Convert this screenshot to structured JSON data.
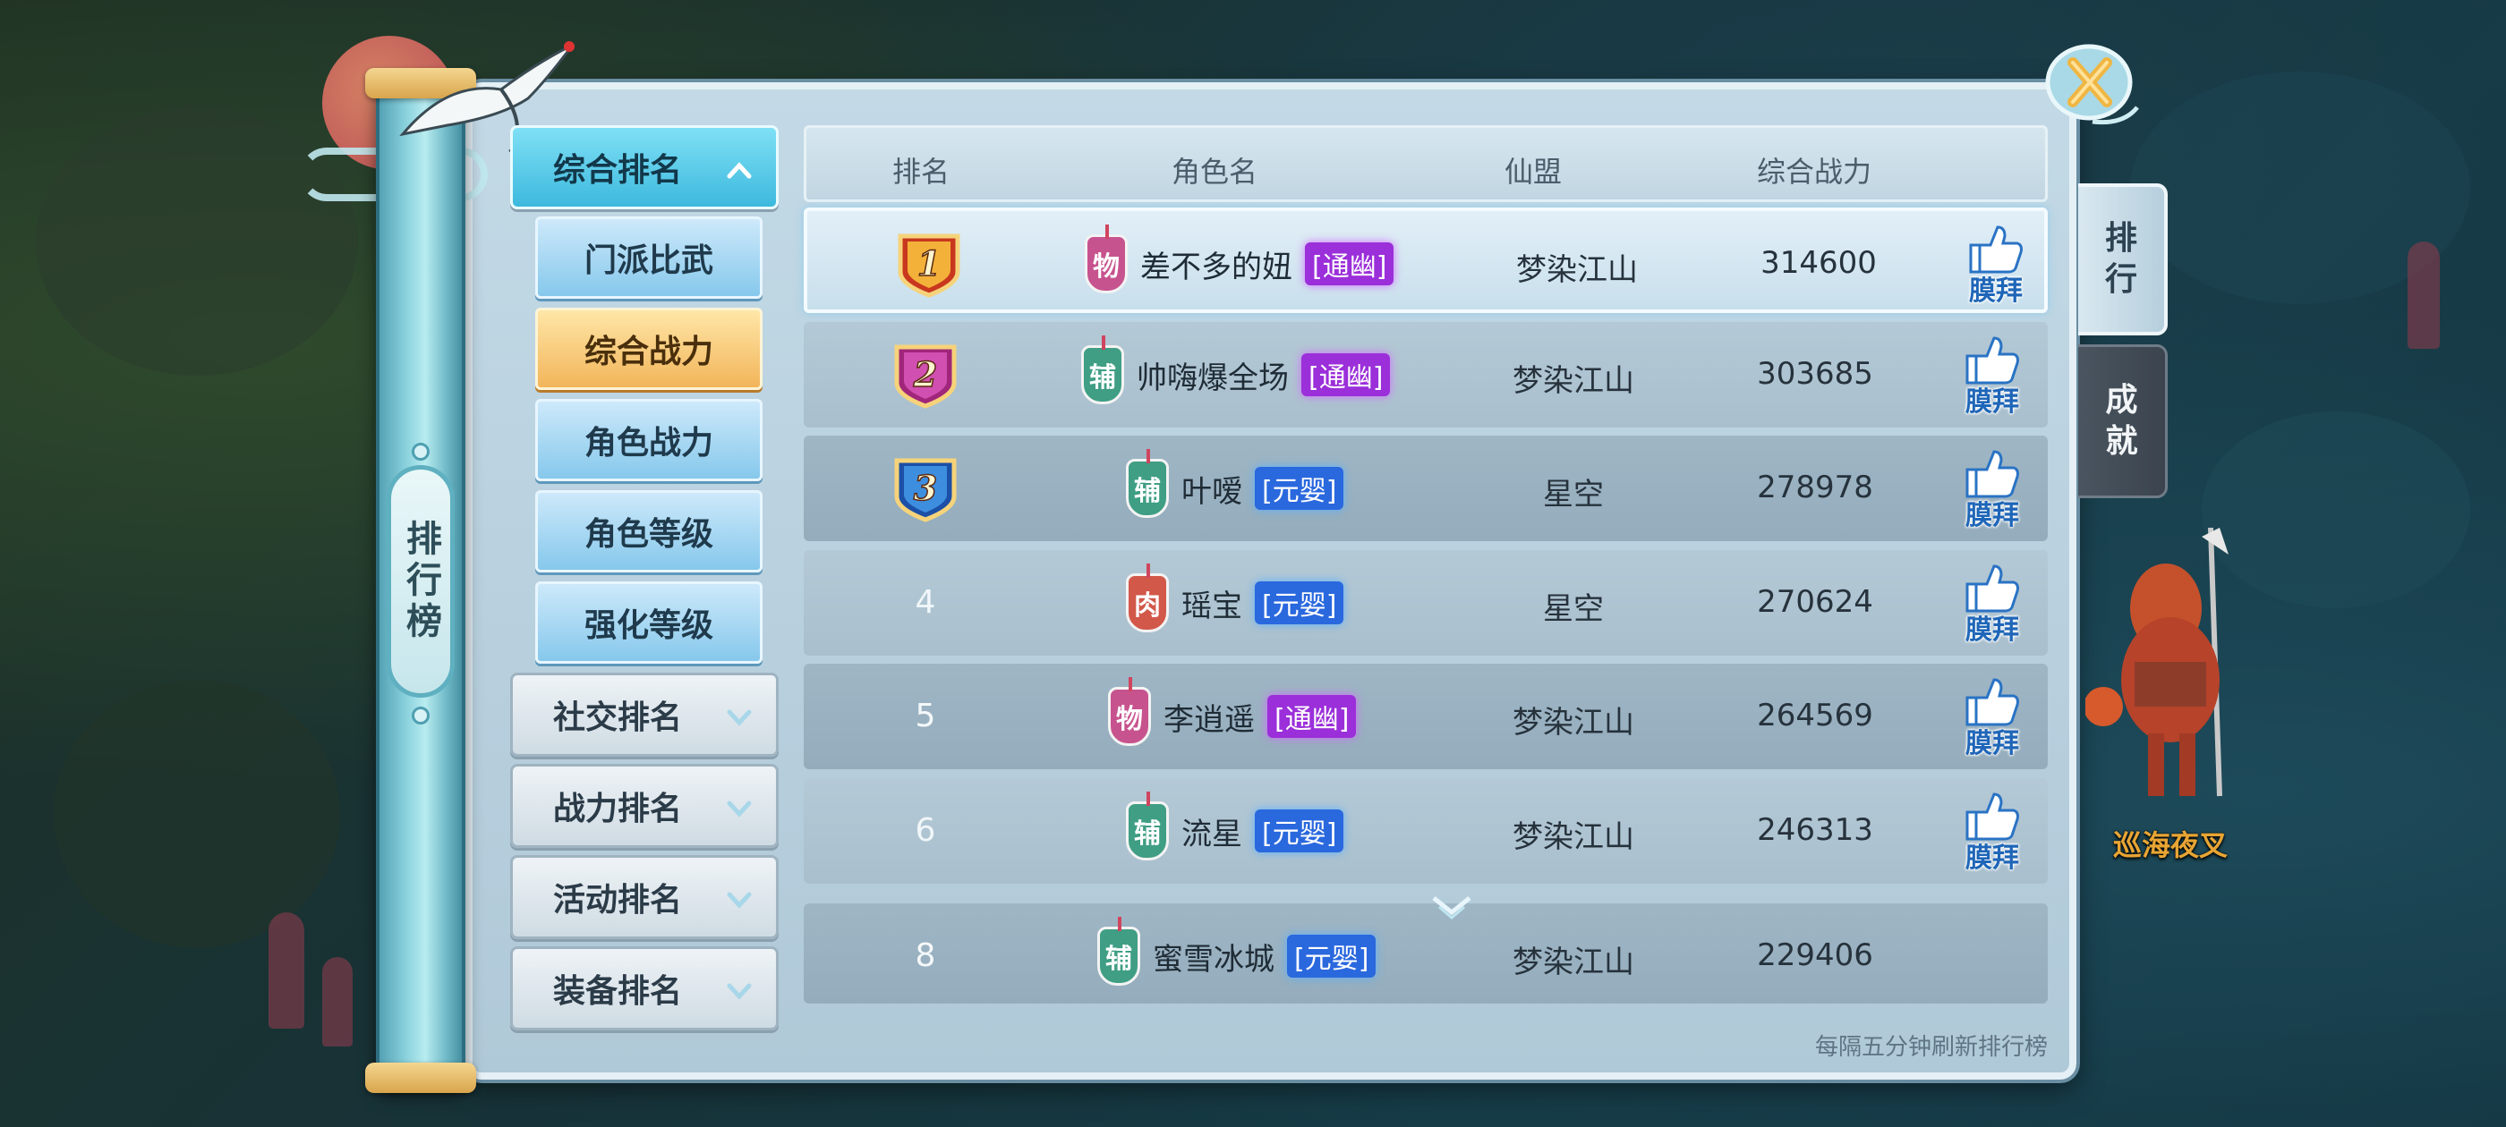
{
  "scroll": {
    "title": "排行榜"
  },
  "categories": [
    {
      "label": "综合排名",
      "expanded": true
    },
    {
      "label": "社交排名",
      "expanded": false
    },
    {
      "label": "战力排名",
      "expanded": false
    },
    {
      "label": "活动排名",
      "expanded": false
    },
    {
      "label": "装备排名",
      "expanded": false
    }
  ],
  "subcategories": [
    {
      "label": "门派比武",
      "selected": false
    },
    {
      "label": "综合战力",
      "selected": true
    },
    {
      "label": "角色战力",
      "selected": false
    },
    {
      "label": "角色等级",
      "selected": false
    },
    {
      "label": "强化等级",
      "selected": false
    }
  ],
  "table": {
    "headers": {
      "rank": "排名",
      "name": "角色名",
      "guild": "仙盟",
      "power": "综合战力"
    },
    "rows": [
      {
        "rank": "1",
        "class_tag": "物",
        "class_color": "#c7538e",
        "name": "差不多的妞",
        "realm": "[通幽]",
        "realm_color": "purple",
        "guild": "梦染江山",
        "power": "314600",
        "worship": "膜拜",
        "medal": "gold"
      },
      {
        "rank": "2",
        "class_tag": "辅",
        "class_color": "#3f9e84",
        "name": "帅嗨爆全场",
        "realm": "[通幽]",
        "realm_color": "purple",
        "guild": "梦染江山",
        "power": "303685",
        "worship": "膜拜",
        "medal": "purple"
      },
      {
        "rank": "3",
        "class_tag": "辅",
        "class_color": "#3f9e84",
        "name": "叶嗳",
        "realm": "[元婴]",
        "realm_color": "blue",
        "guild": "星空",
        "power": "278978",
        "worship": "膜拜",
        "medal": "blue"
      },
      {
        "rank": "4",
        "class_tag": "肉",
        "class_color": "#d2584a",
        "name": "瑶宝",
        "realm": "[元婴]",
        "realm_color": "blue",
        "guild": "星空",
        "power": "270624",
        "worship": "膜拜"
      },
      {
        "rank": "5",
        "class_tag": "物",
        "class_color": "#c7538e",
        "name": "李逍遥",
        "realm": "[通幽]",
        "realm_color": "purple",
        "guild": "梦染江山",
        "power": "264569",
        "worship": "膜拜"
      },
      {
        "rank": "6",
        "class_tag": "辅",
        "class_color": "#3f9e84",
        "name": "流星",
        "realm": "[元婴]",
        "realm_color": "blue",
        "guild": "梦染江山",
        "power": "246313",
        "worship": "膜拜"
      }
    ],
    "my_row": {
      "rank": "8",
      "class_tag": "辅",
      "class_color": "#3f9e84",
      "name": "蜜雪冰城",
      "realm": "[元婴]",
      "realm_color": "blue",
      "guild": "梦染江山",
      "power": "229406"
    }
  },
  "footer_note": "每隔五分钟刷新排行榜",
  "side_tabs": [
    {
      "label": "排\n行",
      "active": true
    },
    {
      "label": "成\n就",
      "active": false
    }
  ],
  "npc": {
    "name": "巡海夜叉"
  },
  "icons": {
    "close": "close-icon",
    "worship": "thumbs-up-icon",
    "expand": "chevron-down-icon",
    "collapse": "chevron-up-icon"
  }
}
